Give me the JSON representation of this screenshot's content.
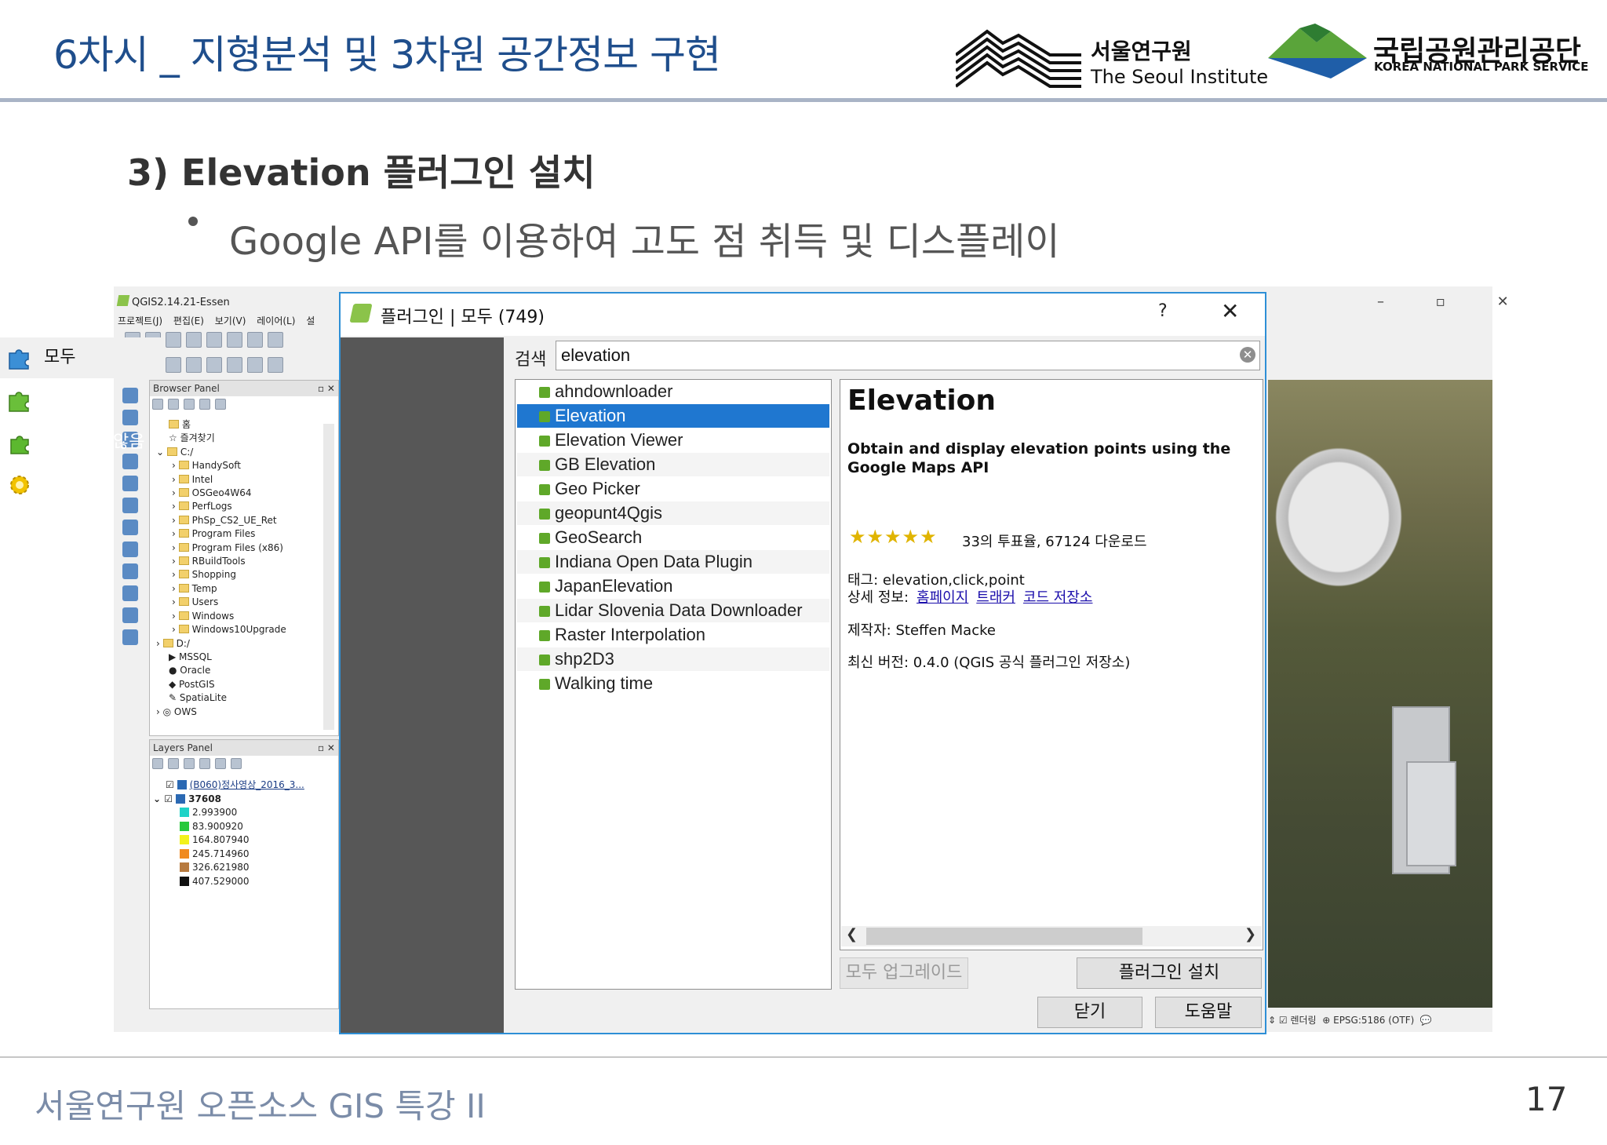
{
  "slide": {
    "title": "6차시 _ 지형분석 및 3차원 공간정보 구현",
    "section_heading": "3) Elevation 플러그인 설치",
    "bullet": "Google API를 이용하여 고도 점 취득 및 디스플레이",
    "footer": "서울연구원 오픈소스 GIS 특강 II",
    "page_number": "17"
  },
  "logos": {
    "seoul_ko": "서울연구원",
    "seoul_en": "The Seoul Institute",
    "knps_ko": "국립공원관리공단",
    "knps_en": "KOREA NATIONAL PARK SERVICE"
  },
  "qgis": {
    "title": "QGIS2.14.21-Essen",
    "menu": [
      "프로젝트(J)",
      "편집(E)",
      "보기(V)",
      "레이어(L)",
      "설"
    ],
    "browser_panel": {
      "label": "Browser Panel",
      "items": [
        "홈",
        "즐겨찾기",
        "C:/",
        "HandySoft",
        "Intel",
        "OSGeo4W64",
        "PerfLogs",
        "PhSp_CS2_UE_Ret",
        "Program Files",
        "Program Files (x86)",
        "RBuildTools",
        "Shopping",
        "Temp",
        "Users",
        "Windows",
        "Windows10Upgrade",
        "D:/",
        "MSSQL",
        "Oracle",
        "PostGIS",
        "SpatiaLite",
        "OWS"
      ]
    },
    "layers_panel": {
      "label": "Layers Panel",
      "layer1": "(B060)정사영상_2016_3...",
      "layer2": "37608",
      "legend": [
        {
          "value": "2.993900",
          "color": "#1fd3c7"
        },
        {
          "value": "83.900920",
          "color": "#27c93c"
        },
        {
          "value": "164.807940",
          "color": "#f2f21c"
        },
        {
          "value": "245.714960",
          "color": "#f08a1f"
        },
        {
          "value": "326.621980",
          "color": "#b77a3f"
        },
        {
          "value": "407.529000",
          "color": "#111111"
        }
      ]
    },
    "window_controls": "–  ▫  ✕",
    "status": {
      "render": "렌더링",
      "crs": "EPSG:5186 (OTF)"
    }
  },
  "dialog": {
    "title": "플러그인 | 모두 (749)",
    "help": "?",
    "close": "✕",
    "sidebar": [
      {
        "label": "모두"
      },
      {
        "label": "설치됨"
      },
      {
        "label": "설치되지 않음"
      },
      {
        "label": "설정"
      }
    ],
    "search_label": "검색",
    "search_value": "elevation",
    "plugins": [
      "ahndownloader",
      "Elevation",
      "Elevation Viewer",
      "GB Elevation",
      "Geo Picker",
      "geopunt4Qgis",
      "GeoSearch",
      "Indiana Open Data Plugin",
      "JapanElevation",
      "Lidar Slovenia Data Downloader",
      "Raster Interpolation",
      "shp2D3",
      "Walking time"
    ],
    "selected_index": 1,
    "detail": {
      "name": "Elevation",
      "description": "Obtain and display elevation points using the Google Maps API",
      "stars": "★★★★★",
      "rating": "33의 투표율, 67124 다운로드",
      "tags_label": "태그:",
      "tags": "elevation,click,point",
      "more_label": "상세 정보:",
      "link_home": "홈페이지",
      "link_tracker": "트래커",
      "link_code": "코드 저장소",
      "author": "제작자: Steffen Macke",
      "version": "최신 버전: 0.4.0 (QGIS 공식 플러그인 저장소)"
    },
    "buttons": {
      "upgrade_all": "모두 업그레이드",
      "install": "플러그인 설치",
      "close": "닫기",
      "help": "도움말"
    }
  }
}
